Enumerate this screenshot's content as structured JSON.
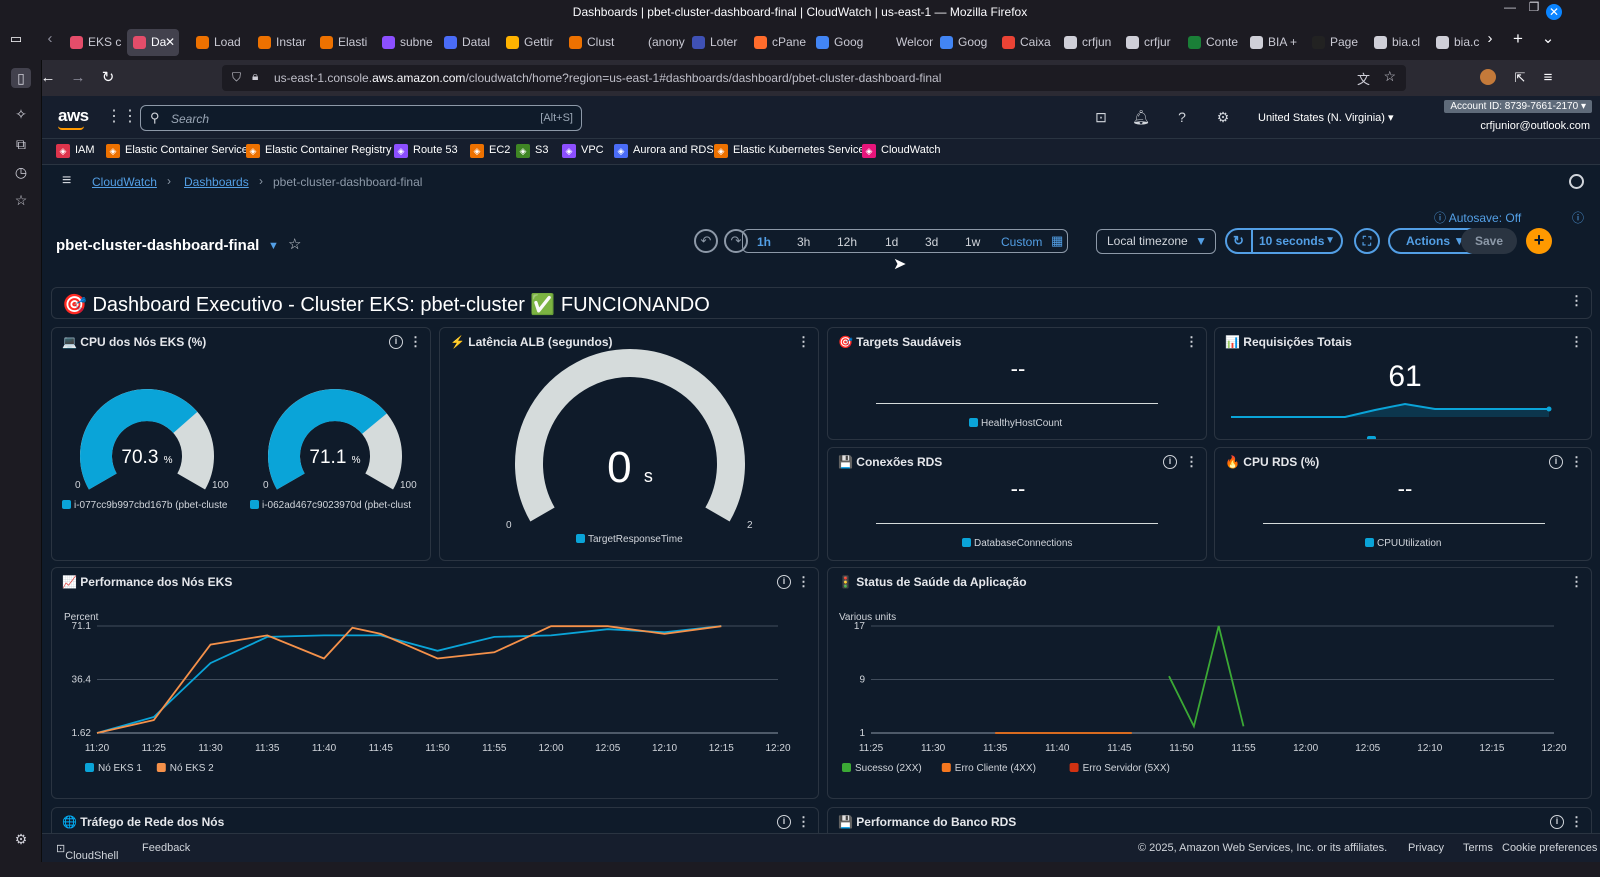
{
  "browser": {
    "window_title": "Dashboards | pbet-cluster-dashboard-final | CloudWatch | us-east-1 — Mozilla Firefox",
    "tabs": [
      {
        "label": "EKS c",
        "color": "#e44d6a"
      },
      {
        "label": "Da",
        "color": "#e44d6a",
        "active": true
      },
      {
        "label": "Load",
        "color": "#ed7100"
      },
      {
        "label": "Instar",
        "color": "#ed7100"
      },
      {
        "label": "Elasti",
        "color": "#ed7100"
      },
      {
        "label": "subne",
        "color": "#8c4fff"
      },
      {
        "label": "Datal",
        "color": "#4a6cf7"
      },
      {
        "label": "Gettir",
        "color": "#ffb300"
      },
      {
        "label": "Clust",
        "color": "#ed7100"
      },
      {
        "label": "(anonym",
        "color": ""
      },
      {
        "label": "Loter",
        "color": "#3f51b5"
      },
      {
        "label": "cPane",
        "color": "#ff6c2c"
      },
      {
        "label": "Goog",
        "color": "#4285f4"
      },
      {
        "label": "Welcome",
        "color": ""
      },
      {
        "label": "Goog",
        "color": "#4285f4"
      },
      {
        "label": "Caixa",
        "color": "#ea4335"
      },
      {
        "label": "crfjun",
        "color": "#cfcfd8"
      },
      {
        "label": "crfjur",
        "color": "#cfcfd8"
      },
      {
        "label": "Conte",
        "color": "#1a7f37"
      },
      {
        "label": "BIA +",
        "color": "#cfcfd8"
      },
      {
        "label": "Page",
        "color": "#222222"
      },
      {
        "label": "bia.cl",
        "color": "#cfcfd8"
      },
      {
        "label": "bia.c",
        "color": "#cfcfd8"
      }
    ],
    "url_prefix": "us-east-1.console.",
    "url_domain": "aws.amazon.com",
    "url_rest": "/cloudwatch/home?region=us-east-1#dashboards/dashboard/pbet-cluster-dashboard-final"
  },
  "aws_header": {
    "logo": "aws",
    "search_placeholder": "Search",
    "search_shortcut": "[Alt+S]",
    "region": "United States (N. Virginia)",
    "account": "Account ID: 8739-7661-2170",
    "user": "crfjunior@outlook.com"
  },
  "favorites": [
    {
      "label": "IAM",
      "color": "#dd344c"
    },
    {
      "label": "Elastic Container Service",
      "color": "#ed7100"
    },
    {
      "label": "Elastic Container Registry",
      "color": "#ed7100"
    },
    {
      "label": "Route 53",
      "color": "#8c4fff"
    },
    {
      "label": "EC2",
      "color": "#ed7100"
    },
    {
      "label": "S3",
      "color": "#3f8624"
    },
    {
      "label": "VPC",
      "color": "#8c4fff"
    },
    {
      "label": "Aurora and RDS",
      "color": "#4a6cf7"
    },
    {
      "label": "Elastic Kubernetes Service",
      "color": "#ed7100"
    },
    {
      "label": "CloudWatch",
      "color": "#e7157b"
    }
  ],
  "breadcrumb": {
    "items": [
      "CloudWatch",
      "Dashboards"
    ],
    "current": "pbet-cluster-dashboard-final"
  },
  "toolbar": {
    "dashboard_name": "pbet-cluster-dashboard-final",
    "ranges": [
      "1h",
      "3h",
      "12h",
      "1d",
      "3d",
      "1w"
    ],
    "selected_range": "1h",
    "custom_label": "Custom",
    "timezone": "Local timezone",
    "refresh": "10 seconds",
    "actions": "Actions",
    "save": "Save",
    "autosave": "Autosave: Off"
  },
  "banner": {
    "text": "🎯 Dashboard Executivo - Cluster EKS: pbet-cluster ✅ FUNCIONANDO"
  },
  "widgets": {
    "cpu_nodes": {
      "title": "💻 CPU dos Nós EKS (%)",
      "gauges": [
        {
          "value": "70.3",
          "unit": "%",
          "min": "0",
          "max": "100",
          "legend": "i-077cc9b997cbd167b (pbet-cluste",
          "fraction": 0.703
        },
        {
          "value": "71.1",
          "unit": "%",
          "min": "0",
          "max": "100",
          "legend": "i-062ad467c9023970d (pbet-clust",
          "fraction": 0.711
        }
      ]
    },
    "alb_latency": {
      "title": "⚡ Latência ALB (segundos)",
      "value": "0",
      "unit": "s",
      "min": "0",
      "max": "2",
      "legend": "TargetResponseTime"
    },
    "healthy_targets": {
      "title": "🎯 Targets Saudáveis",
      "value": "--",
      "legend": "HealthyHostCount"
    },
    "total_requests": {
      "title": "📊 Requisições Totais",
      "value": "61"
    },
    "rds_connections": {
      "title": "💾 Conexões RDS",
      "value": "--",
      "legend": "DatabaseConnections"
    },
    "rds_cpu": {
      "title": "🔥 CPU RDS (%)",
      "value": "--",
      "legend": "CPUUtilization"
    },
    "node_performance": {
      "title": "📈 Performance dos Nós EKS",
      "unit": "Percent"
    },
    "app_health": {
      "title": "🚦 Status de Saúde da Aplicação",
      "unit": "Various units"
    },
    "network_traffic": {
      "title": "🌐 Tráfego de Rede dos Nós"
    },
    "rds_performance": {
      "title": "💾 Performance do Banco RDS"
    }
  },
  "chart_data": [
    {
      "type": "line",
      "title": "📈 Performance dos Nós EKS",
      "ylabel": "Percent",
      "x": [
        "11:20",
        "11:25",
        "11:30",
        "11:35",
        "11:40",
        "11:45",
        "11:50",
        "11:55",
        "12:00",
        "12:05",
        "12:10",
        "12:15",
        "12:20"
      ],
      "y_ticks": [
        "71.1",
        "36.4",
        "1.62"
      ],
      "ylim": [
        1.62,
        71.1
      ],
      "series": [
        {
          "name": "Nó EKS 1",
          "color": "#0aa4d8",
          "points": [
            [
              "11:20",
              1.62
            ],
            [
              "11:25",
              12
            ],
            [
              "11:30",
              47
            ],
            [
              "11:35",
              64
            ],
            [
              "11:40",
              65
            ],
            [
              "11:45",
              65
            ],
            [
              "11:50",
              55
            ],
            [
              "11:55",
              64
            ],
            [
              "12:00",
              65
            ],
            [
              "12:05",
              69
            ],
            [
              "12:10",
              67
            ],
            [
              "12:15",
              71.1
            ]
          ]
        },
        {
          "name": "Nó EKS 2",
          "color": "#f5914a",
          "points": [
            [
              "11:20",
              1.62
            ],
            [
              "11:25",
              10
            ],
            [
              "11:30",
              59
            ],
            [
              "11:35",
              65
            ],
            [
              "11:40",
              50
            ],
            [
              "11:42.5",
              70
            ],
            [
              "11:45",
              66
            ],
            [
              "11:50",
              50
            ],
            [
              "11:55",
              54
            ],
            [
              "12:00",
              71
            ],
            [
              "12:05",
              71
            ],
            [
              "12:10",
              66
            ],
            [
              "12:15",
              71
            ]
          ]
        }
      ]
    },
    {
      "type": "line",
      "title": "🚦 Status de Saúde da Aplicação",
      "ylabel": "Various units",
      "x": [
        "11:25",
        "11:30",
        "11:35",
        "11:40",
        "11:45",
        "11:50",
        "11:55",
        "12:00",
        "12:05",
        "12:10",
        "12:15",
        "12:20"
      ],
      "y_ticks": [
        "17",
        "9",
        "1"
      ],
      "ylim": [
        1,
        17
      ],
      "series": [
        {
          "name": "Sucesso (2XX)",
          "color": "#3ba935",
          "points": [
            [
              "11:49",
              9.5
            ],
            [
              "11:51",
              2
            ],
            [
              "11:53",
              17
            ],
            [
              "11:55",
              2
            ]
          ]
        },
        {
          "name": "Erro Cliente (4XX)",
          "color": "#f5771f",
          "points": [
            [
              "11:35",
              1
            ],
            [
              "11:46",
              1
            ]
          ]
        },
        {
          "name": "Erro Servidor (5XX)",
          "color": "#d13212",
          "points": []
        }
      ]
    }
  ],
  "footer": {
    "cloudshell": "CloudShell",
    "feedback": "Feedback",
    "copyright": "© 2025, Amazon Web Services, Inc. or its affiliates.",
    "privacy": "Privacy",
    "terms": "Terms",
    "cookies": "Cookie preferences"
  }
}
